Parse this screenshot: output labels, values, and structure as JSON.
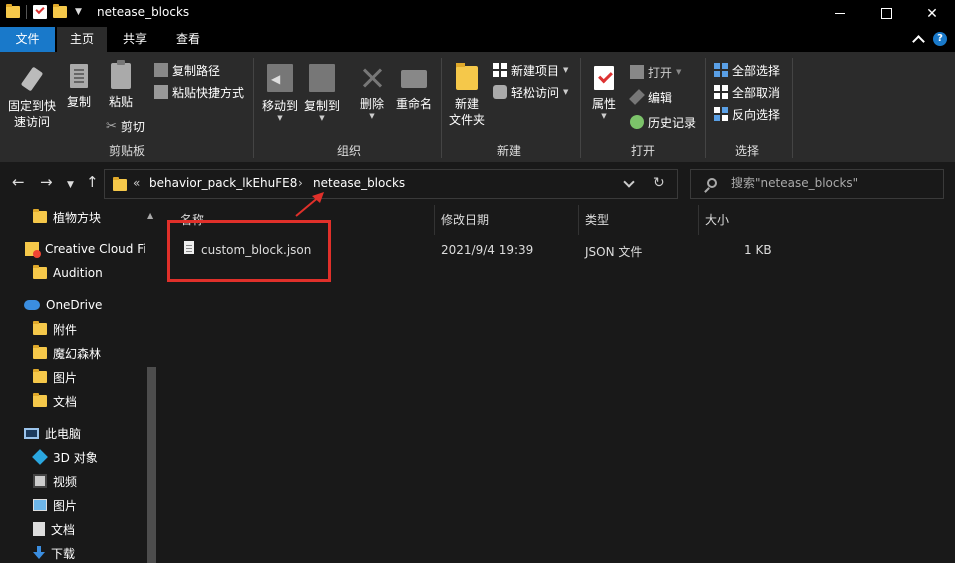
{
  "window": {
    "title": "netease_blocks"
  },
  "menu": {
    "tabs": [
      "文件",
      "主页",
      "共享",
      "查看"
    ]
  },
  "ribbon": {
    "clipboard": {
      "pin_label_1": "固定到快",
      "pin_label_2": "速访问",
      "copy": "复制",
      "paste": "粘贴",
      "copy_path": "复制路径",
      "paste_shortcut": "粘贴快捷方式",
      "cut": "剪切",
      "group": "剪贴板"
    },
    "organize": {
      "move_to": "移动到",
      "copy_to": "复制到",
      "delete": "删除",
      "rename": "重命名",
      "group": "组织"
    },
    "new": {
      "new_folder_1": "新建",
      "new_folder_2": "文件夹",
      "new_item": "新建项目",
      "easy_access": "轻松访问",
      "group": "新建"
    },
    "open": {
      "properties": "属性",
      "open": "打开",
      "edit": "编辑",
      "history": "历史记录",
      "group": "打开"
    },
    "select": {
      "select_all": "全部选择",
      "select_none": "全部取消",
      "invert": "反向选择",
      "group": "选择"
    }
  },
  "address": {
    "overflow": "«",
    "crumbs": [
      "behavior_pack_lkEhuFE8",
      "netease_blocks"
    ],
    "search_placeholder": "搜索\"netease_blocks\""
  },
  "sidebar": {
    "items": [
      "植物方块",
      "Creative Cloud Fi",
      "Audition",
      "OneDrive",
      "附件",
      "魔幻森林",
      "图片",
      "文档",
      "此电脑",
      "3D 对象",
      "视频",
      "图片",
      "文档",
      "下载"
    ]
  },
  "filelist": {
    "columns": [
      "名称",
      "修改日期",
      "类型",
      "大小"
    ],
    "rows": [
      {
        "name": "custom_block.json",
        "modified": "2021/9/4 19:39",
        "type": "JSON 文件",
        "size": "1 KB"
      }
    ]
  },
  "colors": {
    "accent": "#1979ca",
    "highlight": "#e0302a",
    "background": "#191919",
    "ribbon": "#2b2b2b"
  }
}
